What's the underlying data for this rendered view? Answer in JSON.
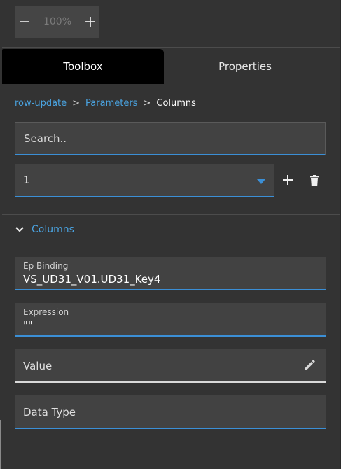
{
  "zoom": {
    "minus_label": "−",
    "value": "100%",
    "plus_label": "+"
  },
  "tabs": [
    {
      "label": "Toolbox",
      "active": true
    },
    {
      "label": "Properties",
      "active": false
    }
  ],
  "breadcrumb": {
    "items": [
      "row-update",
      "Parameters",
      "Columns"
    ],
    "separator": ">"
  },
  "search": {
    "placeholder": "Search.."
  },
  "selector": {
    "value": "1"
  },
  "section": {
    "title": "Columns"
  },
  "fields": {
    "ep_binding": {
      "label": "Ep Binding",
      "value": "VS_UD31_V01.UD31_Key4"
    },
    "expression": {
      "label": "Expression",
      "value": "\"\""
    },
    "value": {
      "placeholder": "Value"
    },
    "data_type": {
      "placeholder": "Data Type"
    }
  },
  "colors": {
    "accent": "#3b8fd6",
    "link": "#4aa3e0",
    "panel": "#333333",
    "field": "#424242"
  }
}
